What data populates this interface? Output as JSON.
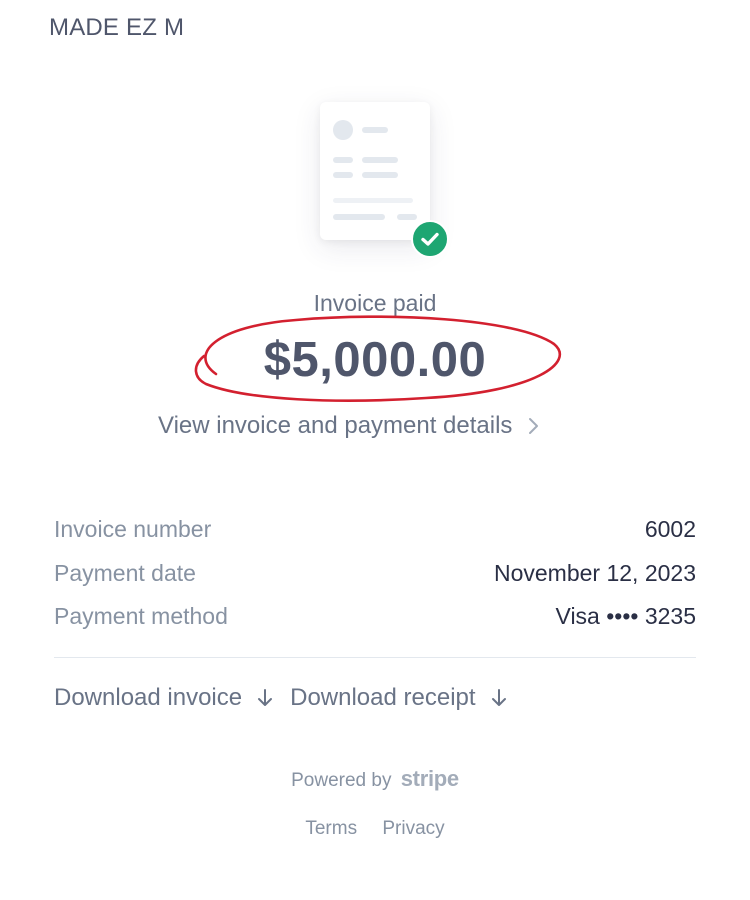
{
  "merchant": {
    "name": "MADE EZ M"
  },
  "status": {
    "label": "Invoice paid"
  },
  "amount": {
    "value": "$5,000.00"
  },
  "details_link": {
    "label": "View invoice and payment details"
  },
  "rows": [
    {
      "label": "Invoice number",
      "value": "6002"
    },
    {
      "label": "Payment date",
      "value": "November 12, 2023"
    },
    {
      "label": "Payment method",
      "value": "Visa •••• 3235"
    }
  ],
  "downloads": {
    "invoice_label": "Download invoice",
    "receipt_label": "Download receipt"
  },
  "footer": {
    "powered_by": "Powered by",
    "brand": "stripe",
    "terms": "Terms",
    "privacy": "Privacy"
  },
  "colors": {
    "success": "#1ea672",
    "annotation": "#d3202f"
  }
}
